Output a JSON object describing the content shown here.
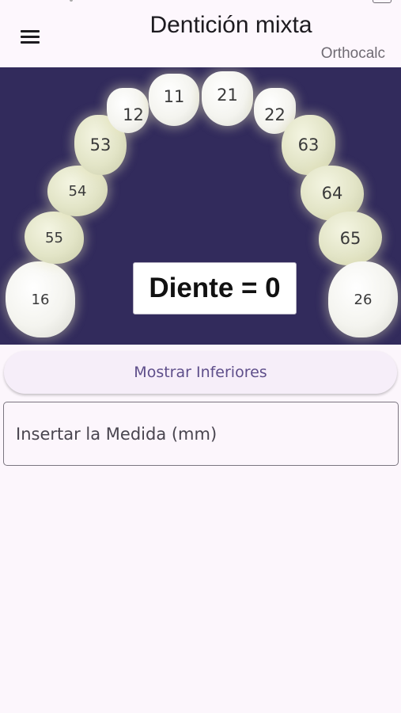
{
  "appbar": {
    "title": "Dentición mixta",
    "subtitle": "Orthocalc",
    "menu_icon": "hamburger-menu-icon"
  },
  "arch": {
    "background": "#322b5c",
    "teeth": [
      "16",
      "55",
      "54",
      "53",
      "12",
      "11",
      "21",
      "22",
      "63",
      "64",
      "65",
      "26"
    ],
    "selected_label": "Diente = 0"
  },
  "actions": {
    "show_lower_label": "Mostrar Inferiores"
  },
  "measurement": {
    "placeholder": "Insertar la Medida (mm)",
    "value": ""
  }
}
